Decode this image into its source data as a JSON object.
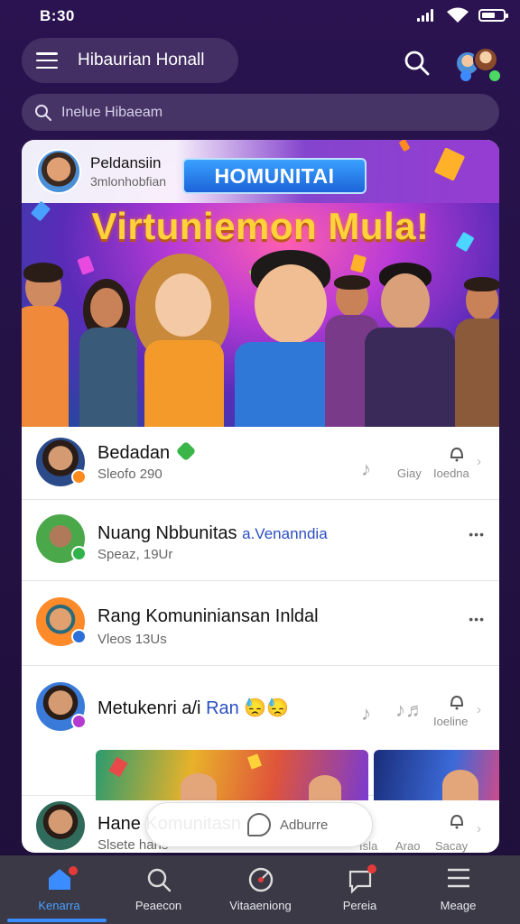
{
  "status_bar": {
    "time": "B:30"
  },
  "header": {
    "title": "Hibaurian Honall",
    "search_placeholder": "Inelue Hibaeam"
  },
  "post": {
    "author_name": "Peldansiin",
    "author_sub": "3mlonhobfian",
    "badge": "HOMUNITAI",
    "headline": "Virtuniemon Mula!"
  },
  "rows": [
    {
      "name": "Bedadan",
      "sub": "Sleofo 290",
      "meta1": "Giay",
      "meta2": "Ioedna",
      "dot_color": "#ff8a1e"
    },
    {
      "name": "Nuang Nbbunitas",
      "highlight": "a.Venanndia",
      "sub": "Speaz, 19Ur",
      "more": "•••",
      "dot_color": "#2fb34a"
    },
    {
      "name": "Rang Komuniniansan Inldal",
      "sub": "Vleos 13Us",
      "more": "•••",
      "dot_color": "#2b6fd8"
    },
    {
      "name": "Metukenri a/i",
      "highlight": "Ran",
      "emoji": "😓😓",
      "sub": "",
      "meta2": "Ioeline",
      "dot_color": "#b43ad0"
    },
    {
      "name": "Hane Komunitasn",
      "sub": "Slsete hans",
      "meta1": "Isla",
      "meta1b": "Arao",
      "meta2": "Sacay",
      "dot_color": "#2fb34a"
    }
  ],
  "now_playing": {
    "label": "Adburre"
  },
  "bottom_nav": [
    {
      "label": "Kenarra",
      "icon": "home-icon",
      "active": true,
      "badge": true
    },
    {
      "label": "Peaecon",
      "icon": "search-icon",
      "active": false
    },
    {
      "label": "Vitaaeniong",
      "icon": "disc-icon",
      "active": false
    },
    {
      "label": "Pereia",
      "icon": "chat-bell-icon",
      "active": false,
      "badge": true
    },
    {
      "label": "Meage",
      "icon": "menu-icon",
      "active": false
    }
  ],
  "colors": {
    "accent": "#3a8cff",
    "background": "#2a1350",
    "nav": "#3a3945",
    "headline": "#ffd23a"
  }
}
